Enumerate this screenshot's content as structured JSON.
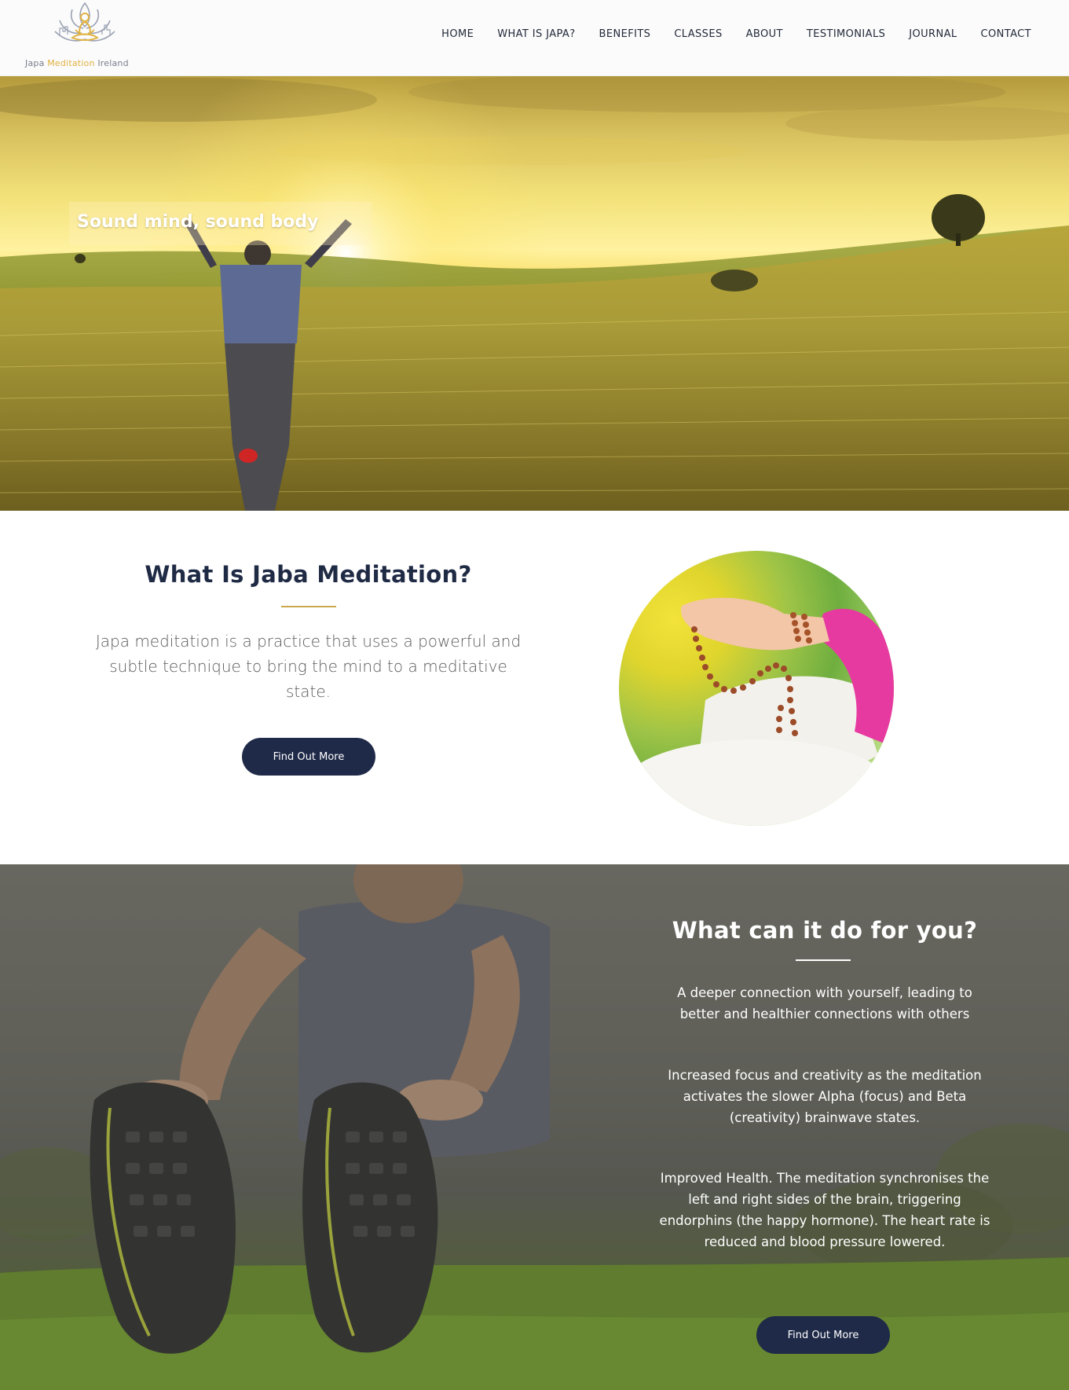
{
  "header": {
    "logo": {
      "word1": "Japa",
      "word2": "Meditation",
      "word3": "Ireland",
      "icon": "lotus-meditation-logo-icon"
    },
    "nav": [
      {
        "label": "HOME"
      },
      {
        "label": "WHAT IS JAPA?"
      },
      {
        "label": "BENEFITS"
      },
      {
        "label": "CLASSES"
      },
      {
        "label": "ABOUT"
      },
      {
        "label": "TESTIMONIALS"
      },
      {
        "label": "JOURNAL"
      },
      {
        "label": "CONTACT"
      }
    ]
  },
  "hero": {
    "tagline": "Sound mind, sound body"
  },
  "what_section": {
    "title": "What Is Jaba Meditation?",
    "text": "Japa meditation is a practice that uses a powerful and subtle technique to bring the mind to a meditative state.",
    "button": "Find Out More"
  },
  "benefits_section": {
    "title": "What can it do for you?",
    "items": [
      "A deeper connection with yourself, leading to better and healthier connections with others",
      "Increased focus and creativity as the meditation activates the slower Alpha (focus) and Beta (creativity) brainwave states.",
      "Improved Health. The meditation synchronises the left and right sides of the brain, triggering endorphins (the happy hormone). The heart rate is reduced and blood pressure lowered."
    ],
    "button": "Find Out More"
  },
  "colors": {
    "navy": "#1f2a48",
    "gold": "#caa94b",
    "logo_gold": "#e1b241"
  }
}
